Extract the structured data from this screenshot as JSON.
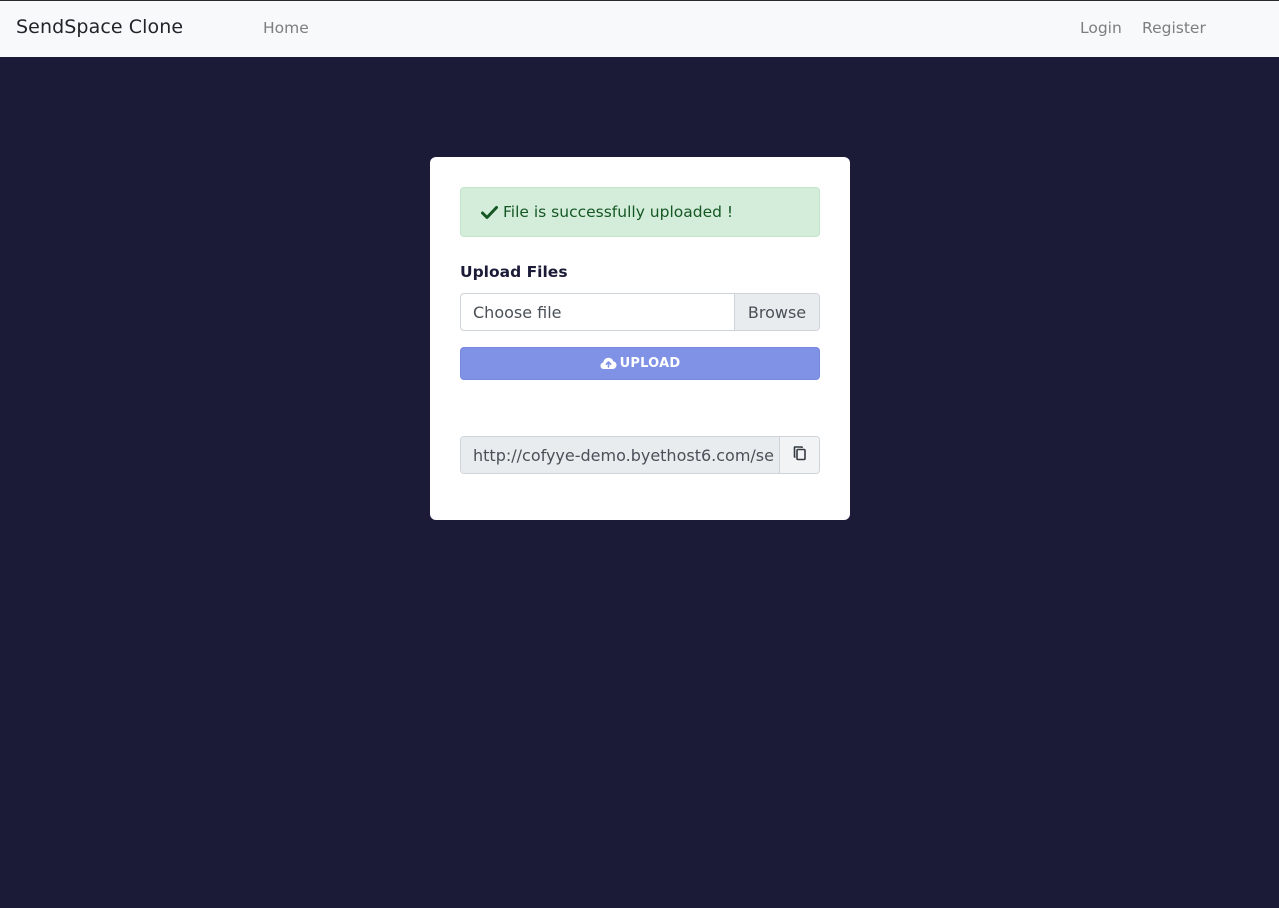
{
  "navbar": {
    "brand": "SendSpace Clone",
    "home": "Home",
    "login": "Login",
    "register": "Register"
  },
  "alert": {
    "icon": "check-icon",
    "message": "File is successfully uploaded !"
  },
  "form": {
    "label": "Upload Files",
    "file_placeholder": "Choose file",
    "browse_label": "Browse",
    "upload_icon": "cloud-upload-icon",
    "upload_label": "UPLOAD"
  },
  "share": {
    "url": "http://cofyye-demo.byethost6.com/se",
    "copy_icon": "copy-icon"
  },
  "colors": {
    "background": "#1b1b38",
    "navbar": "#f8f9fa",
    "alert_bg": "#d4edda",
    "alert_text": "#155724",
    "upload_button": "#8092e6"
  }
}
